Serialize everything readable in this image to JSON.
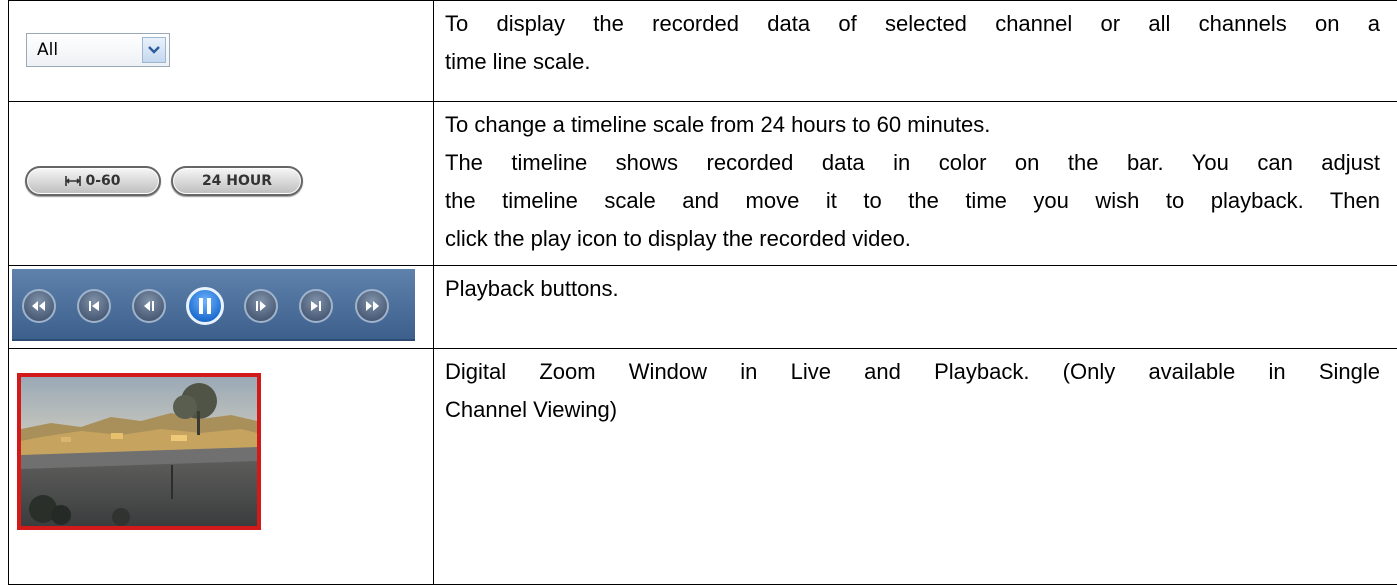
{
  "rows": [
    {
      "control": {
        "select_value": "All"
      },
      "text": [
        "To display the recorded data of selected channel or all channels on a",
        "time line scale."
      ]
    },
    {
      "control": {
        "button_0_60_label": "0-60",
        "button_24h_label": "24 HOUR"
      },
      "text": [
        "To change a timeline scale from 24 hours to 60 minutes.",
        "The timeline shows recorded data in color on the bar. You can adjust",
        "the timeline scale and move it to the time you wish to playback. Then",
        "click the play icon to display the recorded video."
      ]
    },
    {
      "control": {
        "buttons": [
          "fast-rewind",
          "previous",
          "step-back",
          "pause",
          "step-forward",
          "next",
          "fast-forward"
        ],
        "active_button": "pause"
      },
      "text": [
        "Playback buttons."
      ]
    },
    {
      "control": {
        "image": "camera-zoom-preview"
      },
      "text": [
        "Digital Zoom Window in Live and Playback. (Only available in Single",
        "Channel Viewing)"
      ]
    }
  ],
  "colors": {
    "playback_bar": "#4a6d99",
    "active_button": "#1f6fd1",
    "zoom_border": "#d21a1a"
  }
}
